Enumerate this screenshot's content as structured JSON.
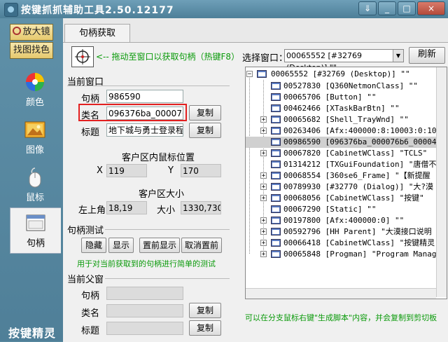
{
  "window": {
    "title": "按键抓抓辅助工具2.50.12177",
    "controls": [
      "⇓",
      "_",
      "□",
      "×"
    ]
  },
  "sidebar": {
    "magnifier_label": "放大镜",
    "find_color_label": "找图找色",
    "items": [
      {
        "label": "颜色",
        "icon": "color-wheel-icon"
      },
      {
        "label": "图像",
        "icon": "picture-icon"
      },
      {
        "label": "鼠标",
        "icon": "mouse-icon"
      },
      {
        "label": "句柄",
        "icon": "window-icon",
        "active": true
      }
    ],
    "logo_text": "按键精灵"
  },
  "tab": {
    "label": "句柄获取"
  },
  "drag_hint": "<-- 拖动至窗口以获取句柄（热键F8）",
  "current_window": {
    "heading": "当前窗口",
    "handle_label": "句柄",
    "handle_value": "986590",
    "class_label": "类名",
    "class_value": "096376ba_000076b6_",
    "title_label": "标题",
    "title_value": "地下城与勇士登录程",
    "copy_label": "复制"
  },
  "client_mouse": {
    "heading": "客户区内鼠标位置",
    "x_label": "X",
    "x_value": "119",
    "y_label": "Y",
    "y_value": "170"
  },
  "client_size": {
    "heading": "客户区大小",
    "topleft_label": "左上角",
    "topleft_value": "18,19",
    "size_label": "大小",
    "size_value": "1330,730"
  },
  "handle_test": {
    "heading": "句柄测试",
    "buttons": [
      "隐藏",
      "显示",
      "置前显示",
      "取消置前"
    ],
    "note": "用于对当前获取到的句柄进行简单的测试"
  },
  "parent_window": {
    "heading": "当前父窗",
    "handle_label": "句柄",
    "class_label": "类名",
    "title_label": "标题",
    "copy_label": "复制"
  },
  "select_window": {
    "label": "选择窗口：",
    "value": "00065552 [#32769 (Desktop)] \"\"",
    "refresh_label": "刷新"
  },
  "tree": {
    "root": "00065552 [#32769 (Desktop)] \"\"",
    "children": [
      {
        "text": "00527830 [Q360NetmonClass] \"\"",
        "expandable": false
      },
      {
        "text": "00065706 [Button] \"\"",
        "expandable": false
      },
      {
        "text": "00462466 [XTaskBarBtn] \"\"",
        "expandable": false
      },
      {
        "text": "00065682 [Shell_TrayWnd] \"\"",
        "expandable": true
      },
      {
        "text": "00263406 [Afx:400000:8:10003:0:10",
        "expandable": true
      },
      {
        "text": "00986590 [096376ba_000076b6_00004",
        "expandable": false,
        "selected": true
      },
      {
        "text": "00067820 [CabinetWClass] \"TCLS\"",
        "expandable": true
      },
      {
        "text": "01314212 [TXGuiFoundation] \"唐僧不",
        "expandable": false
      },
      {
        "text": "00068554 [360se6_Frame] \"【新提醒",
        "expandable": true
      },
      {
        "text": "00789930 [#32770 (Dialog)] \"大?漠",
        "expandable": true
      },
      {
        "text": "00068056 [CabinetWClass] \"按键\"",
        "expandable": true
      },
      {
        "text": "00067290 [Static] \"\"",
        "expandable": false
      },
      {
        "text": "00197800 [Afx:400000:0] \"\"",
        "expandable": true
      },
      {
        "text": "00592796 [HH Parent] \"大漠接口说明",
        "expandable": true
      },
      {
        "text": "00066418 [CabinetWClass] \"按键精灵",
        "expandable": true
      },
      {
        "text": "00065848 [Progman] \"Program Manag",
        "expandable": true
      }
    ]
  },
  "tree_hint": "可以在分支鼠标右键\"生成脚本\"内容，并会复制到剪切板"
}
